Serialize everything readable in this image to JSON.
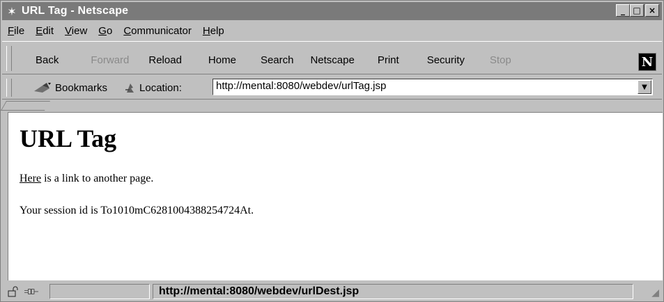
{
  "window": {
    "title": "URL Tag - Netscape",
    "app_icon": "netscape-spider-icon",
    "controls": [
      "minimize-icon",
      "maximize-icon",
      "close-icon"
    ],
    "minimize_glyph": "_",
    "maximize_glyph": "□",
    "close_glyph": "×"
  },
  "menubar": {
    "items": [
      {
        "accel": "F",
        "rest": "ile"
      },
      {
        "accel": "E",
        "rest": "dit"
      },
      {
        "accel": "V",
        "rest": "iew"
      },
      {
        "accel": "G",
        "rest": "o"
      },
      {
        "accel": "C",
        "rest": "ommunicator"
      },
      {
        "accel": "H",
        "rest": "elp"
      }
    ]
  },
  "toolbar": {
    "buttons": [
      {
        "label": "Back",
        "enabled": true
      },
      {
        "label": "Forward",
        "enabled": false
      },
      {
        "label": "Reload",
        "enabled": true
      },
      {
        "label": "Home",
        "enabled": true
      },
      {
        "label": "Search",
        "enabled": true
      },
      {
        "label": "Netscape",
        "enabled": true
      },
      {
        "label": "Print",
        "enabled": true
      },
      {
        "label": "Security",
        "enabled": true
      },
      {
        "label": "Stop",
        "enabled": false
      }
    ],
    "logo_letter": "N"
  },
  "locationbar": {
    "bookmarks_label": "Bookmarks",
    "location_label": "Location:",
    "url": "http://mental:8080/webdev/urlTag.jsp"
  },
  "page": {
    "heading": "URL Tag",
    "link_text": "Here",
    "link_rest": " is a link to another page.",
    "session_text": "Your session id is To1010mC6281004388254724At."
  },
  "statusbar": {
    "text": "http://mental:8080/webdev/urlDest.jsp"
  },
  "colors": {
    "chrome": "#c0c0c0",
    "titlebar": "#7a7a7a",
    "disabled_text": "#8a8a8a"
  }
}
